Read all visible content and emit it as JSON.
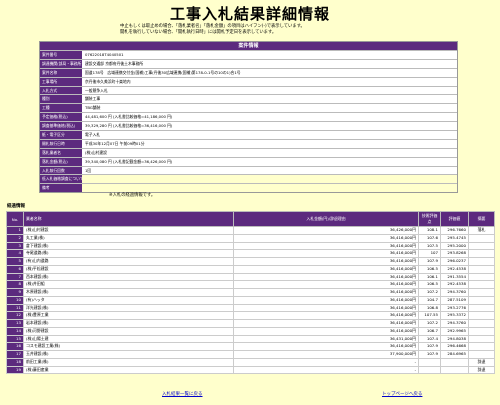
{
  "title": "工事入札結果詳細情報",
  "notes": [
    "中止もしくは取止めの場合、「落札業者名」「落札金額」の項目はハイフン(-)で表示しています。",
    "開札を執行していない場合、「開札執行日時」には開札予定日を表示しています。"
  ],
  "info": {
    "heading": "案件情報",
    "rows": [
      {
        "label": "案件番号",
        "value": "07622018T4040501"
      },
      {
        "label": "調達機関(部局・事務所)",
        "value": "建設交通部 京都府丹後土木事務所"
      },
      {
        "label": "案件名称",
        "value": "国道178号　広域連携交付金(国補)工事(丹後30広域連携(国補)第178-0-1号の10の1)合1号"
      },
      {
        "label": "工事場所",
        "value": "京丹後市久美浜町十楽地内"
      },
      {
        "label": "入札方式",
        "value": "一般競争入札"
      },
      {
        "label": "種別",
        "value": "舗装工事"
      },
      {
        "label": "工種",
        "value": "TBG舗装"
      },
      {
        "label": "予定価格(税込)",
        "value": "44,481,600 円 (入札書比較価格=41,186,000 円)"
      },
      {
        "label": "調査基準価格(税込)",
        "value": "39,329,280 円 (入札書比較価格=36,416,000 円)"
      },
      {
        "label": "紙・電子区分",
        "value": "電子入札"
      },
      {
        "label": "開札執行日時",
        "value": "平成30年12月07日 午前09時01分"
      },
      {
        "label": "落札業者名",
        "value": "(株)山村建設"
      },
      {
        "label": "落札金額(税込)",
        "value": "39,340,080 円 (入札書記載金額=36,426,000 円)"
      },
      {
        "label": "入札執行回数",
        "value": "1回"
      },
      {
        "label": "低入札価格調査について",
        "value": ""
      },
      {
        "label": "備考",
        "value": ""
      }
    ]
  },
  "results_note": "※入札の経過情報です。",
  "results_title": "経過情報",
  "table": {
    "headers": {
      "no": "No.",
      "name": "業者名称",
      "amount": "入札金額(円)/辞退理由",
      "rate": "技術評価点",
      "score": "評価値",
      "remark": "摘要"
    },
    "rows": [
      {
        "no": "1",
        "name": "(株)山村建設",
        "amount": "36,426,000円",
        "rate": "108.1",
        "score": "296.7660",
        "remark": "落札"
      },
      {
        "no": "2",
        "name": "丸工業(株)",
        "amount": "36,416,000円",
        "rate": "107.6",
        "score": "295.4745",
        "remark": ""
      },
      {
        "no": "3",
        "name": "倉下建設(株)",
        "amount": "36,416,000円",
        "rate": "107.5",
        "score": "295.2000",
        "remark": ""
      },
      {
        "no": "4",
        "name": "寺尾道路(株)",
        "amount": "36,416,000円",
        "rate": "107",
        "score": "293.8268",
        "remark": ""
      },
      {
        "no": "5",
        "name": "(有)山内道路",
        "amount": "36,416,000円",
        "rate": "107.9",
        "score": "296.0237",
        "remark": ""
      },
      {
        "no": "6",
        "name": "(株)平松建設",
        "amount": "36,416,000円",
        "rate": "106.5",
        "score": "292.4538",
        "remark": ""
      },
      {
        "no": "7",
        "name": "西本建設(株)",
        "amount": "36,416,000円",
        "rate": "106.1",
        "score": "291.3554",
        "remark": ""
      },
      {
        "no": "8",
        "name": "(株)井田組",
        "amount": "36,416,000円",
        "rate": "106.5",
        "score": "292.4538",
        "remark": ""
      },
      {
        "no": "9",
        "name": "木原建設(株)",
        "amount": "36,416,000円",
        "rate": "107.2",
        "score": "294.3760",
        "remark": ""
      },
      {
        "no": "10",
        "name": "(有)ハッタ",
        "amount": "36,416,000円",
        "rate": "104.7",
        "score": "287.5109",
        "remark": ""
      },
      {
        "no": "11",
        "name": "洋光建設(株)",
        "amount": "36,416,000円",
        "rate": "106.8",
        "score": "293.2776",
        "remark": ""
      },
      {
        "no": "12",
        "name": "(株)豊原工業",
        "amount": "36,416,000円",
        "rate": "107.55",
        "score": "295.3372",
        "remark": ""
      },
      {
        "no": "13",
        "name": "岩本建設(株)",
        "amount": "36,416,000円",
        "rate": "107.2",
        "score": "294.3760",
        "remark": ""
      },
      {
        "no": "14",
        "name": "(株)河野建設",
        "amount": "36,416,000円",
        "rate": "106.7",
        "score": "292.9965",
        "remark": ""
      },
      {
        "no": "15",
        "name": "(株)山陽土建",
        "amount": "36,431,000円",
        "rate": "107.4",
        "score": "294.8038",
        "remark": ""
      },
      {
        "no": "16",
        "name": "コスモ建設工業(株)",
        "amount": "36,416,000円",
        "rate": "107.9",
        "score": "296.4668",
        "remark": ""
      },
      {
        "no": "17",
        "name": "玉井建設(株)",
        "amount": "37,900,000円",
        "rate": "107.9",
        "score": "284.6965",
        "remark": ""
      },
      {
        "no": "18",
        "name": "前田工業(株)",
        "amount": "-",
        "rate": "",
        "score": "",
        "remark": "辞退"
      },
      {
        "no": "19",
        "name": "(株)藤田産業",
        "amount": "-",
        "rate": "",
        "score": "",
        "remark": "辞退"
      }
    ]
  },
  "footer": {
    "back_link": "入札結果一覧に戻る",
    "top_link": "トップページへ戻る"
  }
}
